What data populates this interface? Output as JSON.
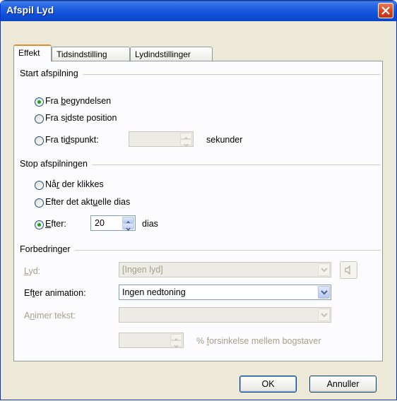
{
  "window": {
    "title": "Afspil Lyd"
  },
  "tabs": [
    {
      "label": "Effekt",
      "active": true
    },
    {
      "label": "Tidsindstilling",
      "active": false
    },
    {
      "label": "Lydindstillinger",
      "active": false
    }
  ],
  "start": {
    "group_label": "Start afspilning",
    "opt1": {
      "pre": "Fra ",
      "u": "b",
      "post": "egyndelsen",
      "checked": true
    },
    "opt2": {
      "pre": "Fra s",
      "u": "i",
      "post": "dste position",
      "checked": false
    },
    "opt3": {
      "pre": "Fra ti",
      "u": "d",
      "post": "spunkt:",
      "checked": false
    },
    "time_value": "",
    "unit": "sekunder"
  },
  "stop": {
    "group_label": "Stop afspilningen",
    "opt1": {
      "pre": "Nå",
      "u": "r",
      "post": " der klikkes",
      "checked": false
    },
    "opt2": {
      "pre": "Efter det akt",
      "u": "u",
      "post": "elle dias",
      "checked": false
    },
    "opt3": {
      "pre": "",
      "u": "E",
      "post": "fter:",
      "checked": true
    },
    "slides_value": "20",
    "unit": "dias"
  },
  "enhancements": {
    "group_label": "Forbedringer",
    "sound": {
      "u": "L",
      "post": "yd:",
      "value": "[Ingen lyd]"
    },
    "after_animation": {
      "pre": "Ef",
      "u": "t",
      "post": "er animation:",
      "value": "Ingen nedtoning"
    },
    "animate_text": {
      "pre": "A",
      "u": "n",
      "post": "imer tekst:",
      "value": ""
    },
    "delay": {
      "value": "",
      "pre": "% ",
      "u": "f",
      "post": "orsinkelse mellem bogstaver"
    }
  },
  "buttons": {
    "ok": "OK",
    "cancel": "Annuller"
  },
  "colors": {
    "titlebar": "#0b46c4",
    "accent": "#e68b2c",
    "radio_dot": "#21a121"
  }
}
